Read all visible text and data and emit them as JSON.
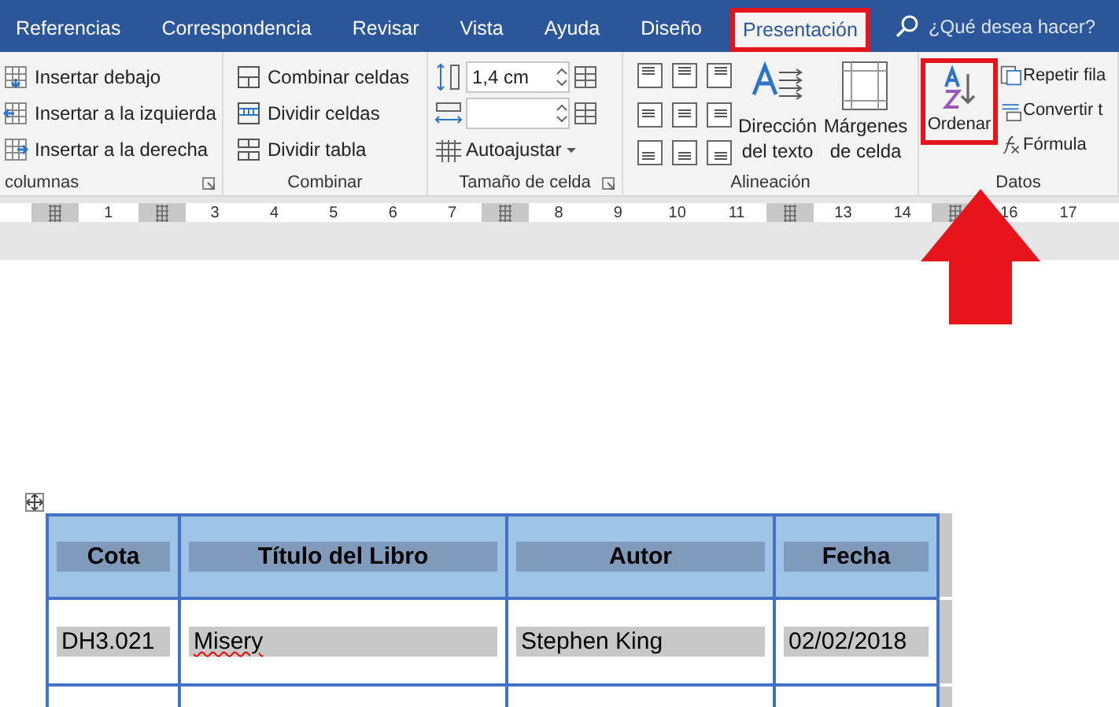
{
  "tabs": [
    {
      "label": "Referencias",
      "selected": false,
      "highlighted": false
    },
    {
      "label": "Correspondencia",
      "selected": false,
      "highlighted": false
    },
    {
      "label": "Revisar",
      "selected": false,
      "highlighted": false
    },
    {
      "label": "Vista",
      "selected": false,
      "highlighted": false
    },
    {
      "label": "Ayuda",
      "selected": false,
      "highlighted": false
    },
    {
      "label": "Diseño",
      "selected": false,
      "highlighted": false
    },
    {
      "label": "Presentación",
      "selected": true,
      "highlighted": true
    }
  ],
  "search": {
    "placeholder": "¿Qué desea hacer?"
  },
  "ribbon": {
    "rows_columns": {
      "label": "columnas",
      "items": [
        "Insertar debajo",
        "Insertar a la izquierda",
        "Insertar a la derecha"
      ]
    },
    "merge": {
      "label": "Combinar",
      "items": [
        "Combinar celdas",
        "Dividir celdas",
        "Dividir tabla"
      ]
    },
    "cell_size": {
      "label": "Tamaño de celda",
      "height": "1,4 cm",
      "autofit": "Autoajustar"
    },
    "alignment": {
      "label": "Alineación",
      "buttons": [
        "Dirección del texto",
        "Márgenes de celda"
      ]
    },
    "data": {
      "label": "Datos",
      "sort": {
        "label": "Ordenar",
        "highlighted": true
      },
      "items": [
        "Repetir fila",
        "Convertir t",
        "Fórmula"
      ]
    }
  },
  "ruler": {
    "marks": [
      {
        "kind": "marker"
      },
      {
        "kind": "number",
        "label": "1"
      },
      {
        "kind": "marker"
      },
      {
        "kind": "number",
        "label": "3"
      },
      {
        "kind": "number",
        "label": "4"
      },
      {
        "kind": "number",
        "label": "5"
      },
      {
        "kind": "number",
        "label": "6"
      },
      {
        "kind": "number",
        "label": "7"
      },
      {
        "kind": "marker"
      },
      {
        "kind": "number",
        "label": "8"
      },
      {
        "kind": "number",
        "label": "9"
      },
      {
        "kind": "number",
        "label": "10"
      },
      {
        "kind": "number",
        "label": "11"
      },
      {
        "kind": "marker"
      },
      {
        "kind": "number",
        "label": "13"
      },
      {
        "kind": "number",
        "label": "14"
      },
      {
        "kind": "marker"
      },
      {
        "kind": "number",
        "label": "16"
      },
      {
        "kind": "number",
        "label": "17"
      }
    ]
  },
  "table": {
    "columns": [
      "Cota",
      "Título del Libro",
      "Autor",
      "Fecha"
    ],
    "rows": [
      {
        "cells": [
          {
            "text": "DH3.021",
            "misspelled": false
          },
          {
            "text": "Misery",
            "misspelled": true
          },
          {
            "text": "Stephen King",
            "misspelled": false
          },
          {
            "text": "02/02/2018",
            "misspelled": false
          }
        ]
      }
    ]
  }
}
